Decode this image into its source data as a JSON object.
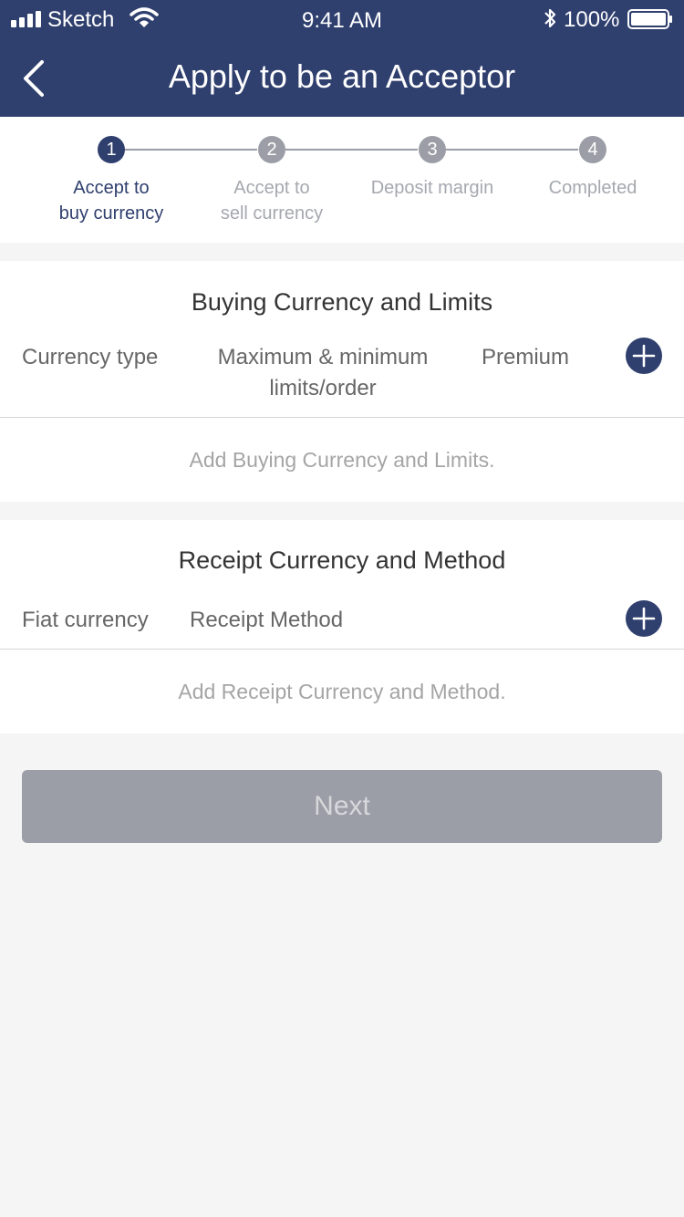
{
  "status_bar": {
    "carrier": "Sketch",
    "time": "9:41 AM",
    "battery": "100%"
  },
  "nav": {
    "title": "Apply to be an Acceptor",
    "back_icon": "chevron-left-icon"
  },
  "stepper": {
    "steps": [
      {
        "number": "1",
        "line1": "Accept to",
        "line2": "buy currency",
        "active": true
      },
      {
        "number": "2",
        "line1": "Accept to",
        "line2": "sell currency",
        "active": false
      },
      {
        "number": "3",
        "line1": "Deposit margin",
        "line2": "",
        "active": false
      },
      {
        "number": "4",
        "line1": "Completed",
        "line2": "",
        "active": false
      }
    ]
  },
  "buying_section": {
    "title": "Buying Currency and Limits",
    "col_currency": "Currency type",
    "col_limits_line1": "Maximum & minimum",
    "col_limits_line2": "limits/order",
    "col_premium": "Premium",
    "empty_hint": "Add Buying Currency and Limits."
  },
  "receipt_section": {
    "title": "Receipt Currency and Method",
    "col_fiat": "Fiat currency",
    "col_method": "Receipt Method",
    "empty_hint": "Add Receipt Currency and Method."
  },
  "next_label": "Next",
  "colors": {
    "primary": "#2f3f6e",
    "inactive": "#9b9ea6",
    "background": "#f5f5f5"
  }
}
